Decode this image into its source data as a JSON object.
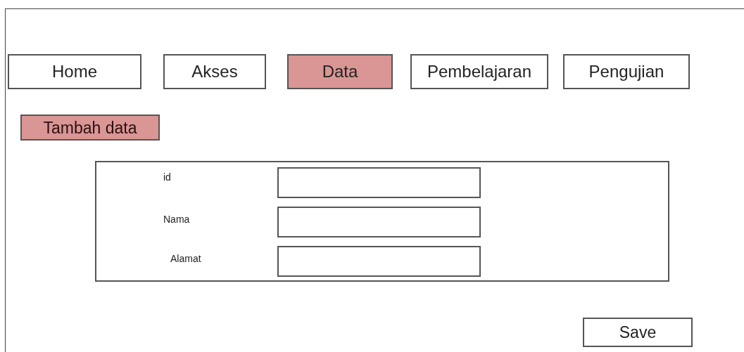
{
  "tabs": [
    {
      "label": "Home",
      "selected": false
    },
    {
      "label": "Akses",
      "selected": false
    },
    {
      "label": "Data",
      "selected": true
    },
    {
      "label": "Pembelajaran",
      "selected": false
    },
    {
      "label": "Pengujian",
      "selected": false
    }
  ],
  "add_button": {
    "label": "Tambah data"
  },
  "form": {
    "fields": [
      {
        "label": "id"
      },
      {
        "label": "Nama"
      },
      {
        "label": "Alamat"
      }
    ]
  },
  "save_button": {
    "label": "Save"
  }
}
